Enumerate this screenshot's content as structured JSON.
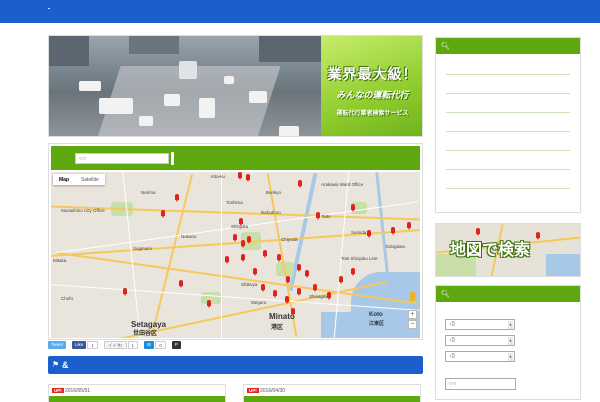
{
  "header": {
    "color": "#1a5fcb"
  },
  "hero": {
    "headline": "業界最大級！",
    "subline": "みんなの運転代行",
    "tagline": "運転代行業者検索サービス",
    "accent": "#8fcc2d"
  },
  "map_search": {
    "placeholder": "○○",
    "map_types": [
      "Map",
      "Satellite"
    ],
    "labels": [
      "Kita-ku",
      "Shinjuku",
      "Nerima",
      "Toshima",
      "Ikebukuro",
      "Shibuya",
      "Setagaya",
      "Minato",
      "Koto",
      "Chiyoda",
      "Taito",
      "Edogawa",
      "Nakano",
      "Suginami",
      "Musashino City Office",
      "Mitaka",
      "Chofu",
      "Meguro",
      "Shinagawa",
      "Sumida",
      "Toei Shinjuku Line",
      "Bunkyo",
      "Arakawa Ward Office"
    ],
    "big_labels": [
      "Setagaya",
      "世田谷区",
      "Minato",
      "港区",
      "Koto",
      "江東区"
    ],
    "zoom_in": "+",
    "zoom_out": "−"
  },
  "share": {
    "tweet": "Tweet",
    "like": "Like",
    "like_count": "1",
    "iine": "イイネ!",
    "iine_count": "1",
    "hatena": "B!",
    "hatena_count": "0",
    "pocket": "P"
  },
  "section": {
    "title": "&"
  },
  "cards": [
    {
      "badge": "UP!",
      "date": "2016/05/01"
    },
    {
      "badge": "UP!",
      "date": "2016/04/30"
    }
  ],
  "sidebar": {
    "search_banner": "地図で検索",
    "selects": [
      "↓()",
      "↓()",
      "↓()"
    ],
    "input_placeholder": "○○"
  }
}
